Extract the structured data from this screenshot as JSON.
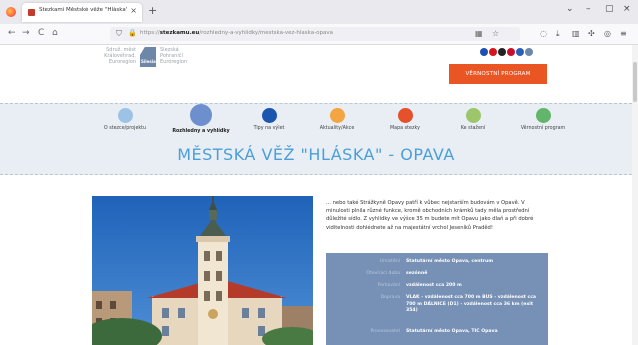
{
  "browser": {
    "tab_title": "Stezkami Městské věže \"Hláska\" - Opava",
    "tab_close": "×",
    "new_tab": "+",
    "back": "←",
    "forward": "→",
    "reload": "C",
    "home": "⌂",
    "url_prefix": "https://",
    "url_domain": "stezkamu.eu",
    "url_path": "/rozhledny-a-vyhlidky/mestska-vez-hlaska-opava",
    "window_controls": [
      "⌄",
      "–",
      "▢",
      "×"
    ]
  },
  "site": {
    "logo_left": [
      "Sdruž. měst",
      "Královéhrad.",
      "Euroregion"
    ],
    "logo_mark": "Silesia",
    "logo_right": [
      "Slezská",
      "Pohraničí",
      "Euroregion"
    ],
    "cta_label": "VĚRNOSTNÍ PROGRAM",
    "flag_colors": [
      "#1e4fb3",
      "#d7141a",
      "#222222",
      "#c8102e",
      "#2a5fb8",
      "#6d87a9"
    ],
    "nav": [
      {
        "label": "O stezce/projektu",
        "color": "#9cc3e6"
      },
      {
        "label": "Rozhledny a vyhlídky",
        "color": "#6e8fce"
      },
      {
        "label": "Tipy na výlet",
        "color": "#1a56b0"
      },
      {
        "label": "Aktuality/Akce",
        "color": "#f2a541"
      },
      {
        "label": "Mapa stezky",
        "color": "#e4512b"
      },
      {
        "label": "Ke stažení",
        "color": "#9bc66a"
      },
      {
        "label": "Věrnostní program",
        "color": "#63b56b"
      }
    ],
    "page_title": "MĚSTSKÁ VĚŽ \"HLÁSKA\" - OPAVA",
    "description": "... nebo také Strážkyně Opavy patří k vůbec nejstarším budovám v Opavě. V minulosti plnila různé funkce, kromě obchodních krámků tady měla prostřední důležité sídlo. Z vyhlídky ve výšce 35 m budete mít Opavu jako dlaň a při dobré viditelnosti dohlédnete až na majestátní vrchol Jeseníků Praděd!",
    "info": [
      {
        "key": "Umístění",
        "value": "Statutární město Opava, centrum"
      },
      {
        "key": "Otevírací doba",
        "value": "sezónně"
      },
      {
        "key": "Parkování",
        "value": "vzdálenost cca 200 m"
      },
      {
        "key": "Doprava",
        "value": "VLAK - vzdálenost cca 700 m BUS - vzdálenost cca 700 m DÁLNICE (D1) - vzdálenost cca 36 km (exit 354)"
      },
      {
        "key": "Provozovatel",
        "value": "Statutární město Opava, TIC Opava"
      }
    ]
  }
}
